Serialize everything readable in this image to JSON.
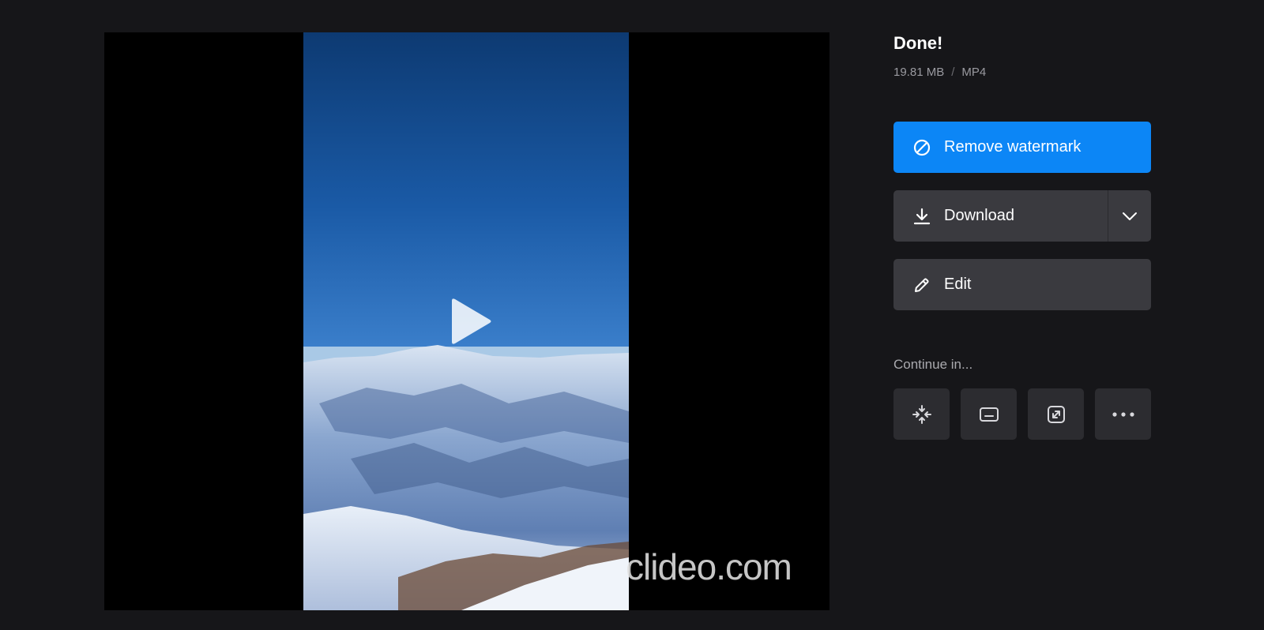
{
  "player": {
    "watermark_text": "clideo.com"
  },
  "status": {
    "title": "Done!",
    "file_size": "19.81 MB",
    "separator": "/",
    "format": "MP4"
  },
  "actions": {
    "remove_watermark_label": "Remove watermark",
    "download_label": "Download",
    "edit_label": "Edit"
  },
  "continue": {
    "label": "Continue in...",
    "tools": [
      {
        "icon": "compress-icon"
      },
      {
        "icon": "subtitles-icon"
      },
      {
        "icon": "resize-icon"
      },
      {
        "icon": "more-icon"
      }
    ]
  },
  "colors": {
    "background": "#161619",
    "primary": "#0c86f6",
    "secondary_button": "#3a3a3f",
    "tool_button": "#2c2c30"
  }
}
